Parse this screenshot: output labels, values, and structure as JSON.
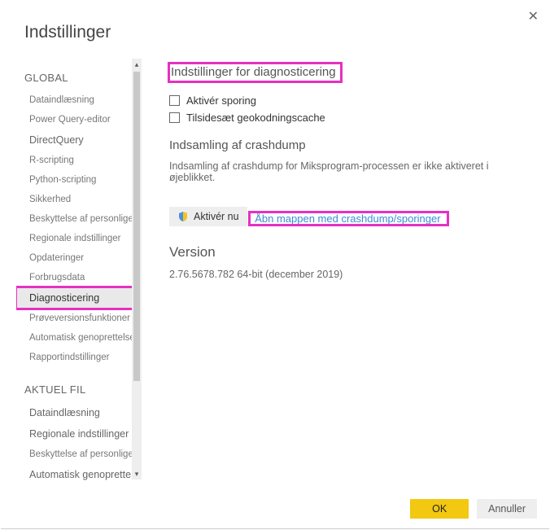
{
  "dialog": {
    "title": "Indstillinger",
    "close_label": "✕"
  },
  "sidebar": {
    "section_global": "GLOBAL",
    "section_current": "AKTUEL FIL",
    "global_items": [
      {
        "label": "Dataindlæsning",
        "small": true
      },
      {
        "label": "Power Query-editor",
        "small": true
      },
      {
        "label": "DirectQuery",
        "small": false
      },
      {
        "label": "R-scripting",
        "small": true
      },
      {
        "label": "Python-scripting",
        "small": true
      },
      {
        "label": "Sikkerhed",
        "small": true
      },
      {
        "label": "Beskyttelse af personlige oplysninger",
        "small": true
      },
      {
        "label": "Regionale indstillinger",
        "small": true
      },
      {
        "label": "Opdateringer",
        "small": true
      },
      {
        "label": "Forbrugsdata",
        "small": true
      },
      {
        "label": "Diagnosticering",
        "selected": true,
        "highlighted": true,
        "small": false
      },
      {
        "label": "Prøveversionsfunktioner",
        "small": true
      },
      {
        "label": "Automatisk genoprettelse",
        "small": true
      },
      {
        "label": "Rapportindstillinger",
        "small": true
      }
    ],
    "current_items": [
      {
        "label": "Dataindlæsning"
      },
      {
        "label": "Regionale indstillinger"
      },
      {
        "label": "Beskyttelse af personlige oplysninger"
      },
      {
        "label": "Automatisk genoprettelse"
      }
    ]
  },
  "content": {
    "diag_heading": "Indstillinger for diagnosticering",
    "enable_tracing": "Aktivér sporing",
    "override_geocoding": "Tilsidesæt geokodningscache",
    "crash_heading": "Indsamling af crashdump",
    "crash_desc": "Indsamling af crashdump for Miksprogram-processen er ikke aktiveret i øjeblikket.",
    "enable_now": "Aktivér nu",
    "open_folder_link": "Åbn mappen med crashdump/sporinger",
    "version_heading": "Version",
    "version_value": "2.76.5678.782 64-bit (december 2019)"
  },
  "footer": {
    "ok": "OK",
    "cancel": "Annuller"
  }
}
